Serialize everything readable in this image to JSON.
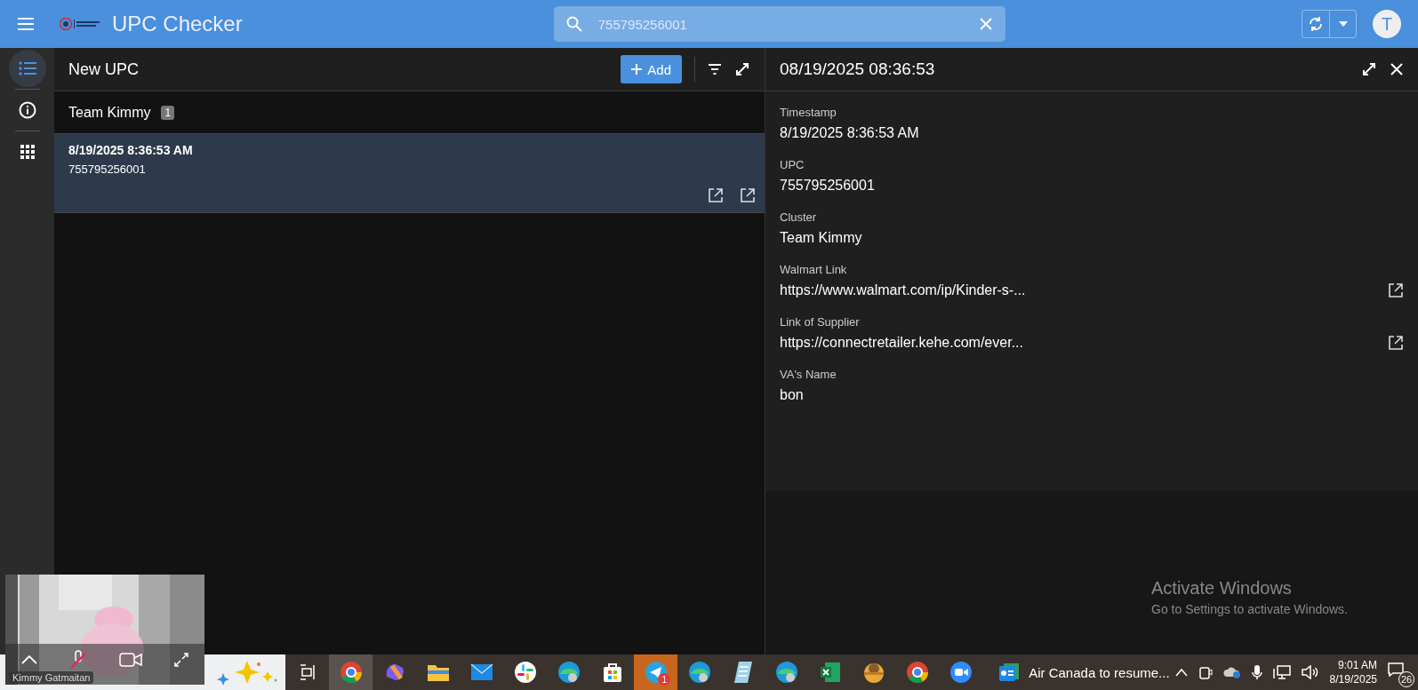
{
  "app": {
    "title": "UPC Checker",
    "search": {
      "value": "755795256001"
    },
    "avatar": "T"
  },
  "rail": [
    {
      "kind": "list",
      "selected": true
    },
    {
      "kind": "info",
      "selected": false
    },
    {
      "kind": "grid",
      "selected": false
    }
  ],
  "list_panel": {
    "title": "New UPC",
    "add_button": "Add",
    "group": {
      "name": "Team Kimmy",
      "count": "1"
    },
    "records": [
      {
        "timestamp": "8/19/2025 8:36:53 AM",
        "upc": "755795256001",
        "selected": true
      }
    ]
  },
  "detail": {
    "title": "08/19/2025 08:36:53",
    "fields": [
      {
        "label": "Timestamp",
        "value": "8/19/2025 8:36:53 AM",
        "kind": "text"
      },
      {
        "label": "UPC",
        "value": "755795256001",
        "kind": "text"
      },
      {
        "label": "Cluster",
        "value": "Team Kimmy",
        "kind": "text"
      },
      {
        "label": "Walmart Link",
        "value": "https://www.walmart.com/ip/Kinder-s-...",
        "kind": "link"
      },
      {
        "label": "Link of Supplier",
        "value": "https://connectretailer.kehe.com/ever...",
        "kind": "link"
      },
      {
        "label": "VA's Name",
        "value": "bon",
        "kind": "text"
      }
    ]
  },
  "activation_notice": {
    "title": "Activate Windows",
    "text": "Go to Settings to activate Windows."
  },
  "video_overlay": {
    "name": "Kimmy Gatmaitan",
    "muted": true
  },
  "taskbar": {
    "telegram_badge": "1",
    "news": "Air Canada to resume...",
    "time": "9:01 AM",
    "date": "8/19/2025",
    "notifications": "26"
  }
}
